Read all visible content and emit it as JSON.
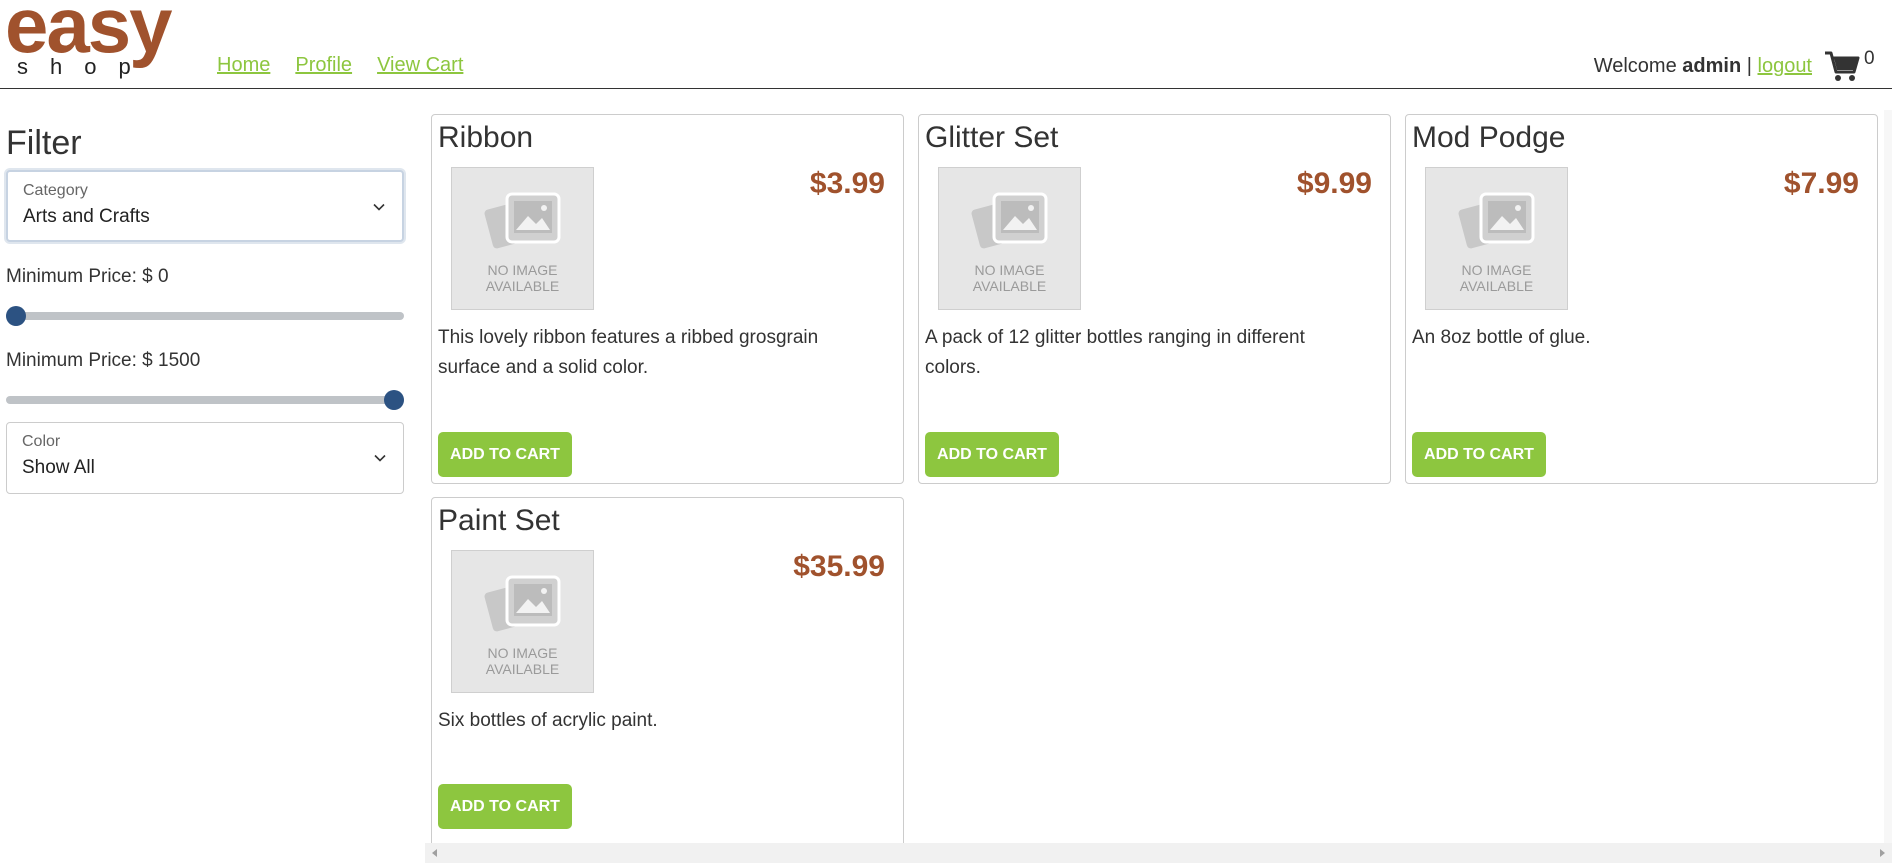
{
  "brand": {
    "logo_top": "easy",
    "logo_bottom": "shop",
    "color": "#a0522d"
  },
  "nav": {
    "home": "Home",
    "profile": "Profile",
    "cart": "View Cart"
  },
  "user": {
    "welcome": "Welcome",
    "name": "admin",
    "separator": "|",
    "logout": "logout",
    "cart_count": "0"
  },
  "filter": {
    "title": "Filter",
    "category": {
      "label": "Category",
      "value": "Arts and Crafts"
    },
    "min_price": {
      "label": "Minimum Price: $ 0",
      "value": 0
    },
    "max_price": {
      "label": "Minimum Price: $ 1500",
      "value": 1500
    },
    "price_range": [
      0,
      1500
    ],
    "color": {
      "label": "Color",
      "value": "Show All"
    }
  },
  "products": [
    {
      "name": "Ribbon",
      "price": "$3.99",
      "description": "This lovely ribbon features a ribbed grosgrain surface and a solid color.",
      "button": "ADD TO CART",
      "image_text": [
        "NO IMAGE",
        "AVAILABLE"
      ]
    },
    {
      "name": "Glitter Set",
      "price": "$9.99",
      "description": "A pack of 12 glitter bottles ranging in different colors.",
      "button": "ADD TO CART",
      "image_text": [
        "NO IMAGE",
        "AVAILABLE"
      ]
    },
    {
      "name": "Mod Podge",
      "price": "$7.99",
      "description": "An 8oz bottle of glue.",
      "button": "ADD TO CART",
      "image_text": [
        "NO IMAGE",
        "AVAILABLE"
      ]
    },
    {
      "name": "Paint Set",
      "price": "$35.99",
      "description": "Six bottles of acrylic paint.",
      "button": "ADD TO CART",
      "image_text": [
        "NO IMAGE",
        "AVAILABLE"
      ]
    }
  ],
  "colors": {
    "accent": "#8dc63f",
    "price": "#a0522d",
    "slider": "#2c5282"
  },
  "icons": {
    "cart": "shopping-cart-icon",
    "chevron": "chevron-down-icon",
    "no_image": "image-placeholder-icon"
  }
}
